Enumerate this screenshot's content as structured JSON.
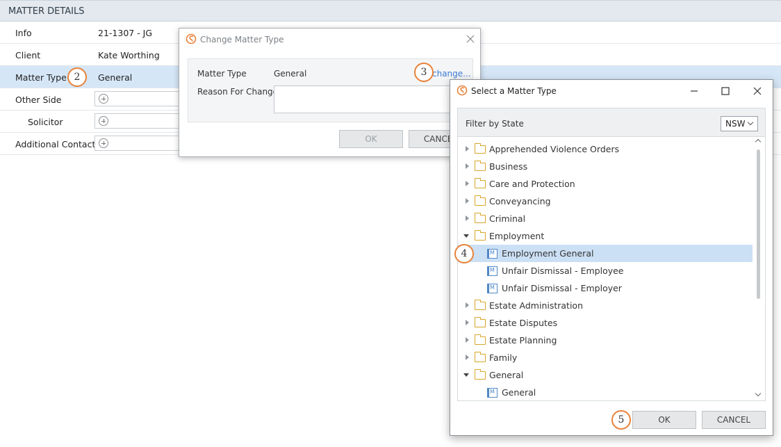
{
  "matter_details": {
    "header": "MATTER DETAILS",
    "rows": [
      {
        "label": "Info",
        "value": "21-1307 - JG"
      },
      {
        "label": "Client",
        "value": "Kate Worthing"
      },
      {
        "label": "Matter Type",
        "value": "General"
      },
      {
        "label": "Other Side",
        "value": ""
      },
      {
        "label": "Solicitor",
        "value": ""
      },
      {
        "label": "Additional Contact",
        "value": ""
      }
    ]
  },
  "badges": {
    "b2": "2",
    "b3": "3",
    "b4": "4",
    "b5": "5"
  },
  "change_dialog": {
    "title": "Change Matter Type",
    "matter_type_label": "Matter Type",
    "matter_type_value": "General",
    "change_link": "change...",
    "reason_label": "Reason For Change",
    "reason_value": "",
    "ok": "OK",
    "cancel": "CANCEL"
  },
  "select_dialog": {
    "title": "Select a Matter Type",
    "filter_label": "Filter by State",
    "state_selected": "NSW",
    "ok": "OK",
    "cancel": "CANCEL",
    "tree": [
      {
        "label": "Apprehended Violence Orders",
        "type": "folder",
        "expanded": false
      },
      {
        "label": "Business",
        "type": "folder",
        "expanded": false
      },
      {
        "label": "Care and Protection",
        "type": "folder",
        "expanded": false
      },
      {
        "label": "Conveyancing",
        "type": "folder",
        "expanded": false
      },
      {
        "label": "Criminal",
        "type": "folder",
        "expanded": false
      },
      {
        "label": "Employment",
        "type": "folder",
        "expanded": true
      },
      {
        "label": "Employment General",
        "type": "matter",
        "selected": true
      },
      {
        "label": "Unfair Dismissal - Employee",
        "type": "matter"
      },
      {
        "label": "Unfair Dismissal - Employer",
        "type": "matter"
      },
      {
        "label": "Estate Administration",
        "type": "folder",
        "expanded": false
      },
      {
        "label": "Estate Disputes",
        "type": "folder",
        "expanded": false
      },
      {
        "label": "Estate Planning",
        "type": "folder",
        "expanded": false
      },
      {
        "label": "Family",
        "type": "folder",
        "expanded": false
      },
      {
        "label": "General",
        "type": "folder",
        "expanded": true
      },
      {
        "label": "General",
        "type": "matter"
      }
    ]
  },
  "colors": {
    "accent_orange": "#e8823a",
    "selection_blue": "#cce0f5",
    "link_blue": "#3b7bd6"
  }
}
